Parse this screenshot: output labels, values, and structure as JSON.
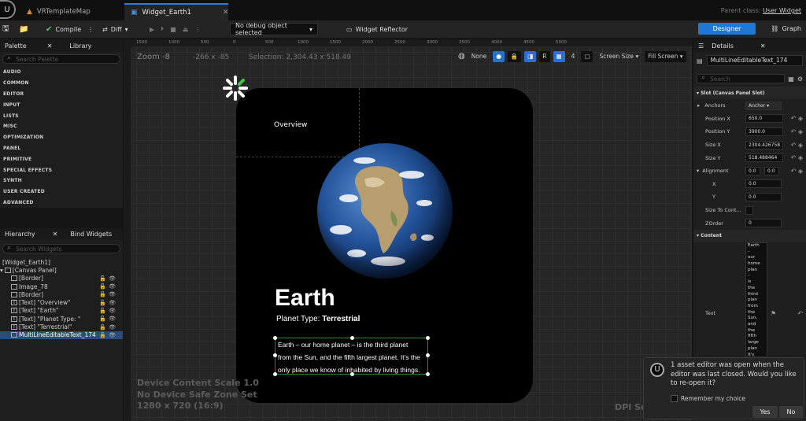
{
  "title_bar": {
    "tabs": [
      {
        "label": "VRTemplateMap",
        "icon": "level-map-icon",
        "active": false
      },
      {
        "label": "Widget_Earth1",
        "icon": "widget-blueprint-icon",
        "active": true
      }
    ],
    "parent_class_label": "Parent class:",
    "parent_class_value": "User Widget"
  },
  "toolbar": {
    "compile_label": "Compile",
    "diff_label": "Diff",
    "debug_select": "No debug object selected",
    "reflector_label": "Widget Reflector",
    "designer_label": "Designer",
    "graph_label": "Graph"
  },
  "palette": {
    "tab_label": "Palette",
    "library_label": "Library",
    "search_placeholder": "Search Palette",
    "categories": [
      "AUDIO",
      "COMMON",
      "EDITOR",
      "INPUT",
      "LISTS",
      "MISC",
      "OPTIMIZATION",
      "PANEL",
      "PRIMITIVE",
      "SPECIAL EFFECTS",
      "SYNTH",
      "USER CREATED",
      "ADVANCED"
    ]
  },
  "hierarchy": {
    "tab_label": "Hierarchy",
    "bind_label": "Bind Widgets",
    "search_placeholder": "Search Widgets",
    "items": [
      {
        "label": "[Widget_Earth1]",
        "depth": 0,
        "icon": ""
      },
      {
        "label": "[Canvas Panel]",
        "depth": 0,
        "icon": "canvas-icon"
      },
      {
        "label": "[Border]",
        "depth": 1,
        "icon": "border-icon"
      },
      {
        "label": "Image_78",
        "depth": 1,
        "icon": "image-icon"
      },
      {
        "label": "[Border]",
        "depth": 1,
        "icon": "border-icon"
      },
      {
        "label": "[Text] \"Overview\"",
        "depth": 1,
        "icon": "text-icon"
      },
      {
        "label": "[Text] \"Earth\"",
        "depth": 1,
        "icon": "text-icon"
      },
      {
        "label": "[Text] \"Planet Type: \"",
        "depth": 1,
        "icon": "text-icon"
      },
      {
        "label": "[Text] \"Terrestrial\"",
        "depth": 1,
        "icon": "text-icon"
      },
      {
        "label": "MultiLineEditableText_174",
        "depth": 1,
        "icon": "multiline-text-icon",
        "selected": true
      }
    ]
  },
  "viewport": {
    "zoom": "Zoom -8",
    "coords": "-266 x -85",
    "selection": "Selection: 2,304.43 x 518.49",
    "ruler_ticks": [
      "1500",
      "1000",
      "500",
      "0",
      "500",
      "1000",
      "1500",
      "2000",
      "2500",
      "3000",
      "3500",
      "4000",
      "4500",
      "5000"
    ],
    "none_label": "None",
    "r_label": "R",
    "grid_count": "4",
    "screen_size": "Screen Size",
    "fill_screen": "Fill Screen",
    "device_info": [
      "Device Content Scale 1.0",
      "No Device Safe Zone Set",
      "1280 x 720 (16:9)"
    ],
    "dpi_scale": "DPI Sc"
  },
  "widget": {
    "overview": "Overview",
    "title": "Earth",
    "planet_type_label": "Planet Type: ",
    "planet_type_value": "Terrestrial",
    "description_lines": [
      "Earth – our home planet – is the third planet",
      "from the Sun, and the fifth largest planet. It's the",
      "only place we know of inhabited by living things."
    ]
  },
  "details": {
    "tab_label": "Details",
    "object_name": "MultiLineEditableText_174",
    "search_placeholder": "Search",
    "slot_section": "Slot (Canvas Panel Slot)",
    "anchors_label": "Anchors",
    "anchors_value": "Anchor",
    "position_x_label": "Position X",
    "position_x": "650.0",
    "position_y_label": "Position Y",
    "position_y": "3900.0",
    "size_x_label": "Size X",
    "size_x": "2304.426758",
    "size_y_label": "Size Y",
    "size_y": "518.488464",
    "alignment_label": "Alignment",
    "alignment_a": "0.0",
    "alignment_b": "0.0",
    "x_label": "X",
    "x_value": "0.0",
    "y_label": "Y",
    "y_value": "0.0",
    "size_to_content_label": "Size To Cont...",
    "zorder_label": "ZOrder",
    "zorder_value": "0",
    "content_section": "Content",
    "text_label": "Text",
    "text_value_lines": [
      "Earth",
      "–",
      "our",
      "home",
      "plan",
      "–",
      "is",
      "the",
      "third",
      "plan",
      "from",
      "the",
      "Sun,",
      "and",
      "the",
      "fifth",
      "large",
      "plan",
      "It's"
    ]
  },
  "toast": {
    "message": "1 asset editor was open when the editor was last closed. Would you like to re-open it?",
    "remember_label": "Remember my choice",
    "yes_label": "Yes",
    "no_label": "No"
  },
  "colors": {
    "accent_blue": "#1e78d6",
    "selection_green": "#2c8c2c",
    "background": "#151515"
  }
}
